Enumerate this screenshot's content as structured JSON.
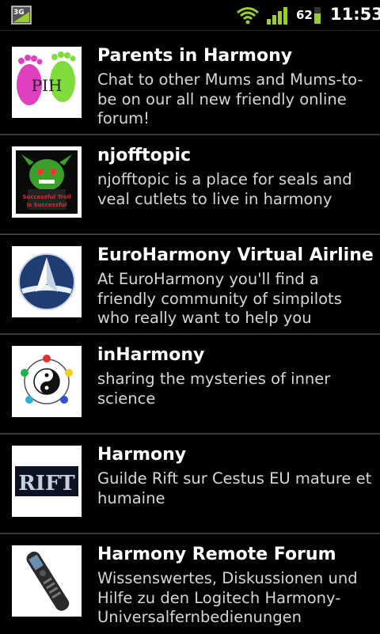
{
  "status_bar": {
    "network": "3G",
    "battery": "62",
    "time": "11:53"
  },
  "items": [
    {
      "title": "Parents in Harmony",
      "description": "Chat to other Mums and Mums-to-be on our all new friendly online forum!",
      "thumb_text": "PIH",
      "icon": "footprints-logo"
    },
    {
      "title": "njofftopic",
      "description": "njofftopic is a place for seals and veal cutlets to live in harmony",
      "thumb_text": "Successful Troll is Successful",
      "icon": "troll-meme-image"
    },
    {
      "title": "EuroHarmony Virtual Airline",
      "description": "At EuroHarmony you'll find a friendly community of simpilots who really want to help you",
      "icon": "airline-globe-logo"
    },
    {
      "title": "inHarmony",
      "description": "sharing the mysteries of inner science",
      "icon": "yin-yang-logo"
    },
    {
      "title": "Harmony",
      "description": "Guilde Rift sur Cestus EU mature et humaine",
      "thumb_text": "RIFT",
      "icon": "rift-logo"
    },
    {
      "title": "Harmony Remote Forum",
      "description": "Wissenswertes, Diskussionen und Hilfe zu den Logitech Harmony-Universalfernbedienungen",
      "icon": "remote-control-image"
    }
  ]
}
